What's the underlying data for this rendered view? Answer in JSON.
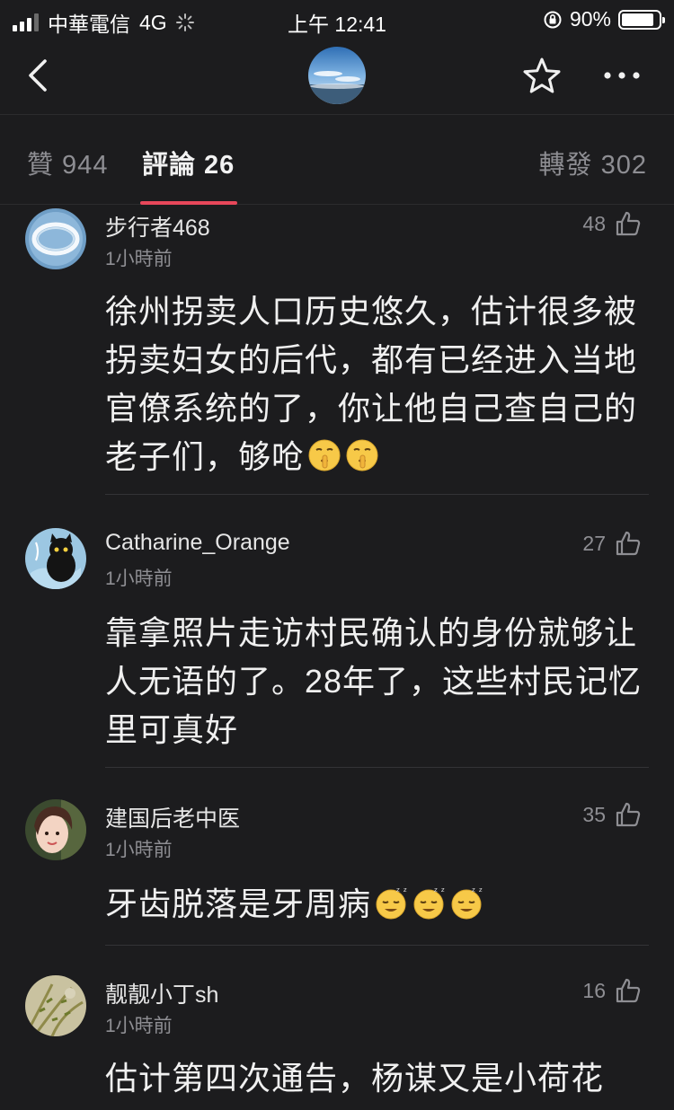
{
  "status": {
    "carrier": "中華電信",
    "network": "4G",
    "time": "上午 12:41",
    "battery": "90%"
  },
  "nav": {
    "back_icon": "chevron-left-icon",
    "avatar_icon": "avatar",
    "favorite_icon": "star-icon",
    "more_icon": "more-icon"
  },
  "tabs": {
    "likes_label": "贊 944",
    "comments_label": "評論 26",
    "reposts_label": "轉發 302"
  },
  "comments": [
    {
      "username": "步行者468",
      "time": "1小時前",
      "likes": "48",
      "text": "徐州拐卖人口历史悠久，估计很多被拐卖妇女的后代，都有已经进入当地官僚系统的了，你让他自己查自己的老子们，够呛",
      "emojis": [
        "shush-emoji",
        "shush-emoji"
      ]
    },
    {
      "username": "Catharine_Orange",
      "time": "1小時前",
      "likes": "27",
      "text": "靠拿照片走访村民确认的身份就够让人无语的了。28年了，这些村民记忆里可真好",
      "emojis": []
    },
    {
      "username": "建国后老中医",
      "time": "1小時前",
      "likes": "35",
      "text": "牙齿脱落是牙周病",
      "emojis": [
        "sleepy-emoji",
        "sleepy-emoji",
        "sleepy-emoji"
      ]
    },
    {
      "username": "靓靓小丁sh",
      "time": "1小時前",
      "likes": "16",
      "text": "估计第四次通告，杨谋又是小荷花",
      "emojis": []
    }
  ],
  "colors": {
    "background": "#1c1c1e",
    "accent": "#e8475a",
    "muted": "#8e8e93"
  }
}
